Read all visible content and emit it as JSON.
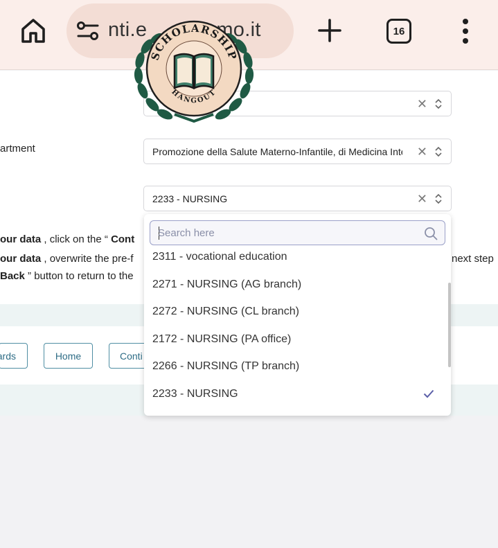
{
  "browser": {
    "url_text": "nti.e",
    "url_text_tail": "mo.it",
    "tab_count": "16"
  },
  "form": {
    "department_label": "artment",
    "department_value": "Promozione della Salute Materno-Infantile, di Medicina Interna e Sp",
    "course_value": "2233 - NURSING"
  },
  "instructions": {
    "line1_bold": "our data",
    "line1_mid": " , click on the “ ",
    "line1_bold2": "Cont",
    "line2_bold": "our data",
    "line2_mid": " , overwrite the pre-f",
    "line2_tail": "next step",
    "line3_bold": "Back",
    "line3_mid": " ” button to return to the"
  },
  "buttons": {
    "back_partial": "ards",
    "home": "Home",
    "continue_partial": "Conti"
  },
  "dropdown": {
    "search_placeholder": "Search here",
    "options": [
      "2311 - vocational education",
      "2271 - NURSING (AG branch)",
      "2272 - NURSING (CL branch)",
      "2172 - NURSING (PA office)",
      "2266 - NURSING (TP branch)",
      "2233 - NURSING"
    ],
    "selected": "2233 - NURSING"
  },
  "logo": {
    "top_text": "SCHOLARSHIP",
    "bottom_text": "HANGOUT"
  },
  "colors": {
    "browser_bar": "#fbeeea",
    "url_pill": "#f3ddd5",
    "accent_teal": "#2f6d86",
    "band": "#edf4f4",
    "check": "#5b5fa8",
    "laurel": "#1f5a44",
    "medallion": "#f3d9c2"
  }
}
